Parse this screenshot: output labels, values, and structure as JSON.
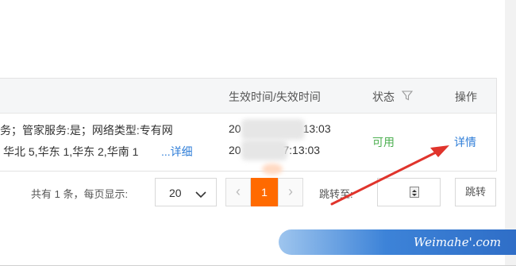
{
  "table": {
    "headers": {
      "time": "生效时间/失效时间",
      "status": "状态",
      "ops": "操作"
    },
    "row": {
      "info_line1": "务；管家服务:是；网络类型:专有网",
      "info_line2": "华北 5,华东 1,华东 2,华南 1",
      "info_more": "...详细",
      "time_start_prefix": "20",
      "time_start_suffix": "13:03",
      "time_end_prefix": "20",
      "time_end_suffix": "17:13:03",
      "status": "可用",
      "detail": "详情"
    }
  },
  "pagination": {
    "total_text": "共有 1 条，每页显示:",
    "page_size": "20",
    "prev": "‹",
    "current_page": "1",
    "next": "›",
    "jump_label": "跳转至:",
    "jump_button": "跳转"
  },
  "watermark": {
    "text": "Weimahe'.com"
  },
  "colors": {
    "accent": "#ff6a00",
    "link": "#2f7ed8",
    "status_ok": "#4caf50",
    "arrow": "#e0342c"
  }
}
